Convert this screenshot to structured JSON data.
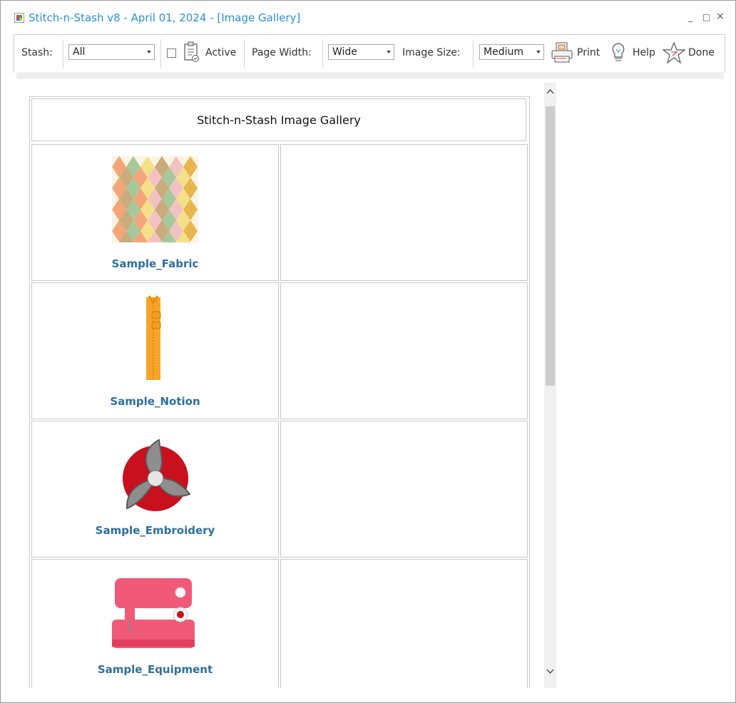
{
  "window": {
    "title": "Stitch-n-Stash v8 - April 01, 2024 - [Image Gallery]",
    "controls": {
      "minimize": "_",
      "maximize": "□",
      "close": "×"
    }
  },
  "toolbar": {
    "stash_label": "Stash:",
    "stash_value": "All",
    "active_label": "Active",
    "active_checked": false,
    "page_width_label": "Page Width:",
    "page_width_value": "Wide",
    "image_size_label": "Image Size:",
    "image_size_value": "Medium",
    "print_label": "Print",
    "help_label": "Help",
    "done_label": "Done"
  },
  "gallery": {
    "title": "Stitch-n-Stash Image Gallery",
    "items": [
      {
        "name": "Sample_Fabric",
        "icon": "fabric-swatch-icon"
      },
      {
        "name": "Sample_Notion",
        "icon": "zipper-icon"
      },
      {
        "name": "Sample_Embroidery",
        "icon": "embroidery-logo-icon"
      },
      {
        "name": "Sample_Equipment",
        "icon": "sewing-machine-icon"
      }
    ]
  },
  "colors": {
    "title_text": "#2b8fd0",
    "item_link": "#2e6f9e",
    "embroidery_red": "#c8101e",
    "machine_pink": "#f05a78",
    "zipper_orange": "#f7a52a"
  }
}
